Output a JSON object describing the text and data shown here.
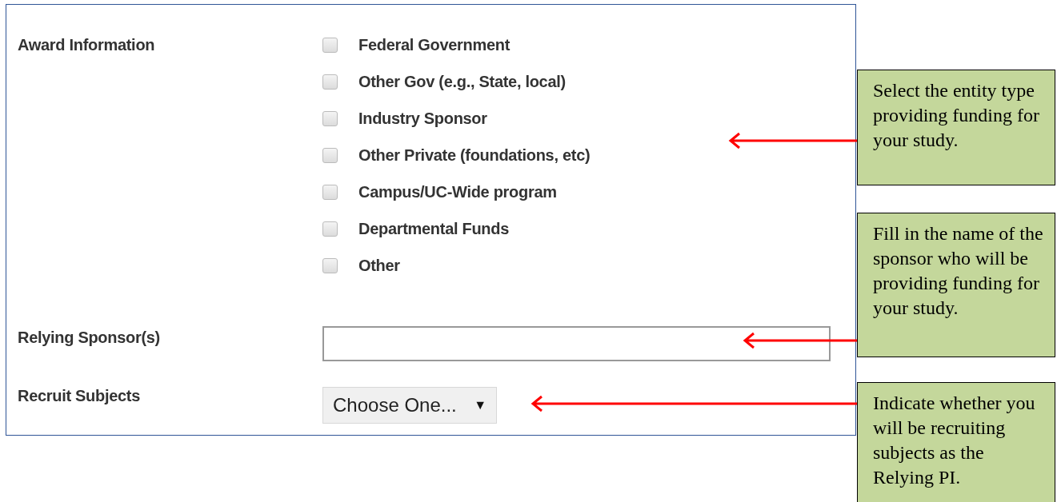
{
  "form": {
    "fields": [
      {
        "kind": "checkboxes",
        "label": "Award Information",
        "options": [
          {
            "label": "Federal Government",
            "checked": false
          },
          {
            "label": "Other Gov (e.g., State, local)",
            "checked": false
          },
          {
            "label": "Industry Sponsor",
            "checked": false
          },
          {
            "label": "Other Private (foundations, etc)",
            "checked": false
          },
          {
            "label": "Campus/UC-Wide program",
            "checked": false
          },
          {
            "label": "Departmental Funds",
            "checked": false
          },
          {
            "label": "Other",
            "checked": false
          }
        ]
      },
      {
        "kind": "text",
        "label": "Relying Sponsor(s)"
      },
      {
        "kind": "select",
        "label": "Recruit Subjects",
        "value": "Choose One...",
        "caret": "▼"
      }
    ]
  },
  "callouts": [
    {
      "text": "Select the entity type providing funding for your study."
    },
    {
      "text": "Fill in the name of the sponsor who will be providing funding for your study."
    },
    {
      "text": "Indicate whether you will be recruiting subjects as the Relying PI."
    }
  ]
}
